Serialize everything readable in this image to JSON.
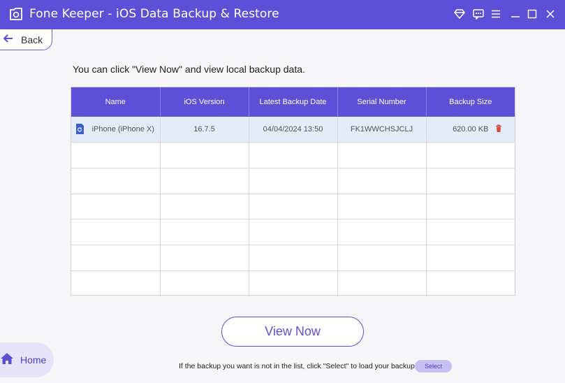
{
  "app": {
    "title": "Fone Keeper - iOS Data Backup & Restore",
    "accent": "#5c50d6"
  },
  "titlebar": {
    "icons": [
      "diamond-icon",
      "feedback-icon",
      "menu-icon",
      "minimize-icon",
      "maximize-icon",
      "close-icon"
    ]
  },
  "back": {
    "label": "Back"
  },
  "hint": "You can click \"View Now\" and view local backup data.",
  "table": {
    "columns": [
      "Name",
      "iOS Version",
      "Latest Backup Date",
      "Serial Number",
      "Backup Size"
    ],
    "rows": [
      {
        "name": "iPhone (iPhone X)",
        "ios_version": "16.7.5",
        "date": "04/04/2024 13:50",
        "serial": "FK1WWCHSJCLJ",
        "size": "620.00 KB"
      }
    ],
    "empty_rows": 6
  },
  "view_now": "View Now",
  "footer": {
    "text": "If the backup you want is not in the list, click \"Select\" to load your backup.",
    "select": "Select"
  },
  "home": {
    "label": "Home"
  }
}
